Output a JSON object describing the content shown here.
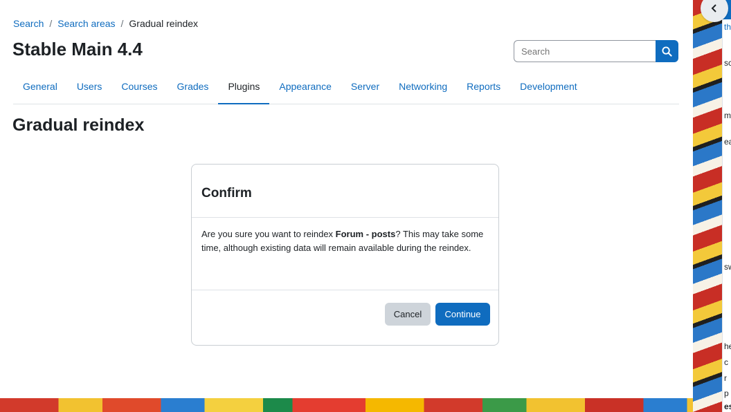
{
  "breadcrumb": {
    "items": [
      "Search",
      "Search areas"
    ],
    "current": "Gradual reindex",
    "separator": "/"
  },
  "site": {
    "title": "Stable Main 4.4"
  },
  "search": {
    "placeholder": "Search"
  },
  "tabs": [
    "General",
    "Users",
    "Courses",
    "Grades",
    "Plugins",
    "Appearance",
    "Server",
    "Networking",
    "Reports",
    "Development"
  ],
  "active_tab": "Plugins",
  "page": {
    "heading": "Gradual reindex"
  },
  "modal": {
    "title": "Confirm",
    "body_before": "Are you sure you want to reindex ",
    "body_bold": "Forum - posts",
    "body_after": "? This may take some time, although existing data will remain available during the reindex.",
    "cancel_label": "Cancel",
    "continue_label": "Continue"
  },
  "drawer": {
    "partial_texts": [
      "th",
      "sc",
      "me",
      "ea",
      "sw",
      "he",
      "c",
      "r",
      "p",
      "es"
    ]
  },
  "colors": {
    "primary": "#0f6cbf",
    "text": "#1d2125",
    "secondary_button": "#ced4da"
  }
}
